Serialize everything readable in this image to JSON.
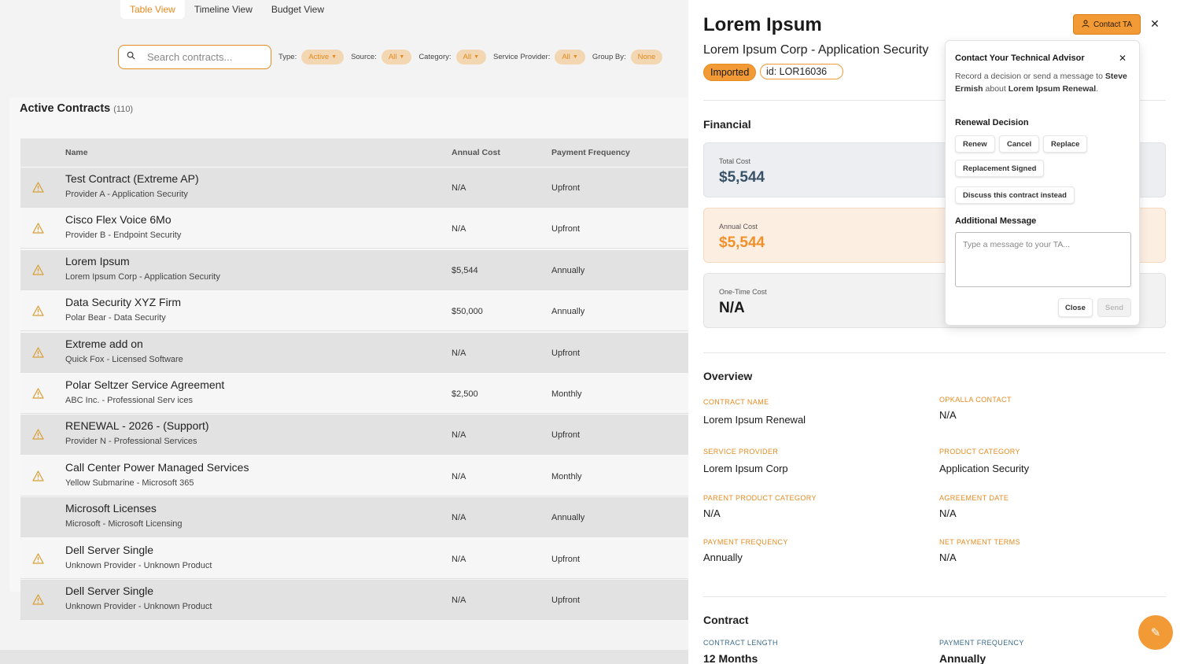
{
  "tabs": [
    {
      "label": "Table View",
      "active": true
    },
    {
      "label": "Timeline View",
      "active": false
    },
    {
      "label": "Budget View",
      "active": false
    }
  ],
  "search": {
    "placeholder": "Search contracts..."
  },
  "filters": {
    "type": {
      "label": "Type:",
      "value": "Active"
    },
    "source": {
      "label": "Source:",
      "value": "All"
    },
    "category": {
      "label": "Category:",
      "value": "All"
    },
    "service_provider": {
      "label": "Service Provider:",
      "value": "All"
    },
    "group_by": {
      "label": "Group By:",
      "value": "None"
    }
  },
  "contracts": {
    "title": "Active Contracts",
    "count": "(110)",
    "columns": {
      "name": "Name",
      "annual_cost": "Annual Cost",
      "payment_frequency": "Payment Frequency"
    },
    "rows": [
      {
        "name": "Test Contract (Extreme AP)",
        "sub": "Provider A - Application Security",
        "cost": "N/A",
        "freq": "Upfront",
        "warning": true
      },
      {
        "name": "Cisco Flex Voice 6Mo",
        "sub": "Provider B - Endpoint Security",
        "cost": "N/A",
        "freq": "Upfront",
        "warning": true
      },
      {
        "name": "Lorem Ipsum",
        "sub": "Lorem Ipsum Corp - Application Security",
        "cost": "$5,544",
        "freq": "Annually",
        "warning": true
      },
      {
        "name": "Data Security XYZ Firm",
        "sub": "Polar Bear - Data Security",
        "cost": "$50,000",
        "freq": "Annually",
        "warning": true
      },
      {
        "name": "Extreme add on",
        "sub": "Quick Fox - Licensed Software",
        "cost": "N/A",
        "freq": "Upfront",
        "warning": true
      },
      {
        "name": "Polar Seltzer Service Agreement",
        "sub": "ABC Inc. - Professional Serv ices",
        "cost": "$2,500",
        "freq": "Monthly",
        "warning": true
      },
      {
        "name": "RENEWAL - 2026 - (Support)",
        "sub": "Provider N - Professional Services",
        "cost": "N/A",
        "freq": "Upfront",
        "warning": true
      },
      {
        "name": "Call Center Power Managed Services",
        "sub": "Yellow Submarine - Microsoft 365",
        "cost": "N/A",
        "freq": "Monthly",
        "warning": true
      },
      {
        "name": "Microsoft Licenses",
        "sub": "Microsoft - Microsoft Licensing",
        "cost": "N/A",
        "freq": "Annually",
        "warning": false
      },
      {
        "name": "Dell Server Single",
        "sub": "Unknown Provider - Unknown Product",
        "cost": "N/A",
        "freq": "Upfront",
        "warning": true
      },
      {
        "name": "Dell Server Single",
        "sub": "Unknown Provider - Unknown Product",
        "cost": "N/A",
        "freq": "Upfront",
        "warning": true
      }
    ]
  },
  "drawer": {
    "title": "Lorem Ipsum",
    "subtitle": "Lorem Ipsum Corp - Application Security",
    "badge": "Imported",
    "id_label": "id: LOR16036",
    "contact_button": "Contact TA",
    "close_icon": "close-icon",
    "financial": {
      "title": "Financial",
      "total_cost": {
        "label": "Total Cost",
        "value": "$5,544"
      },
      "annual_cost": {
        "label": "Annual Cost",
        "value": "$5,544"
      },
      "one_time_cost": {
        "label": "One-Time Cost",
        "value": "N/A"
      }
    },
    "overview": {
      "title": "Overview",
      "contract_name": {
        "label": "CONTRACT NAME",
        "value": "Lorem Ipsum Renewal"
      },
      "opkalla_contact": {
        "label": "OPKALLA CONTACT",
        "value": "N/A"
      },
      "service_provider": {
        "label": "SERVICE PROVIDER",
        "value": "Lorem Ipsum Corp"
      },
      "product_category": {
        "label": "PRODUCT CATEGORY",
        "value": "Application Security"
      },
      "parent_product_category": {
        "label": "PARENT PRODUCT CATEGORY",
        "value": "N/A"
      },
      "agreement_date": {
        "label": "AGREEMENT DATE",
        "value": "N/A"
      },
      "payment_frequency": {
        "label": "PAYMENT FREQUENCY",
        "value": "Annually"
      },
      "net_payment_terms": {
        "label": "NET PAYMENT TERMS",
        "value": "N/A"
      }
    },
    "contract": {
      "title": "Contract",
      "contract_length": {
        "label": "CONTRACT LENGTH",
        "value": "12 Months"
      },
      "payment_frequency": {
        "label": "PAYMENT FREQUENCY",
        "value": "Annually"
      }
    }
  },
  "popover": {
    "title": "Contact Your Technical Advisor",
    "desc_prefix": "Record a decision or send a message to ",
    "advisor": "Steve Ermish",
    "desc_mid": " about ",
    "contract": "Lorem Ipsum Renewal",
    "desc_suffix": ".",
    "renewal_decision": "Renewal Decision",
    "options": {
      "renew": "Renew",
      "cancel": "Cancel",
      "replace": "Replace",
      "replacement_signed": "Replacement Signed",
      "discuss": "Discuss this contract instead"
    },
    "additional_message": "Additional Message",
    "message_placeholder": "Type a message to your TA...",
    "close": "Close",
    "send": "Send"
  },
  "colors": {
    "accent": "#f29a35",
    "accent_dark": "#e58a1f",
    "slate": "#3a5268"
  }
}
